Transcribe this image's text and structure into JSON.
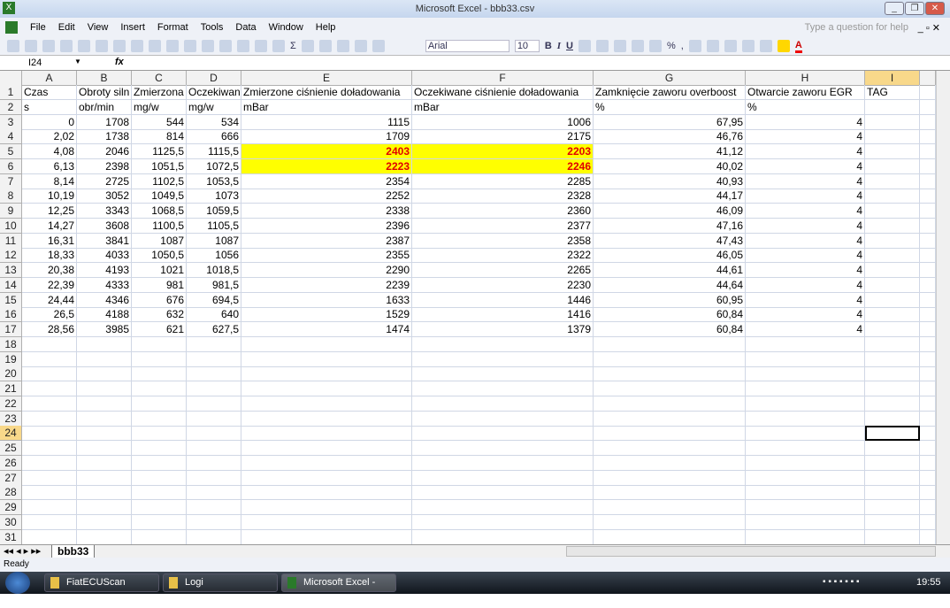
{
  "window": {
    "title": "Microsoft Excel - bbb33.csv"
  },
  "menu": [
    "File",
    "Edit",
    "View",
    "Insert",
    "Format",
    "Tools",
    "Data",
    "Window",
    "Help"
  ],
  "help_box": "Type a question for help",
  "toolbar": {
    "font": "Arial",
    "size": "10",
    "sigma": "Σ"
  },
  "formula_bar": {
    "name_box": "I24",
    "fx": "fx",
    "value": ""
  },
  "columns": [
    "A",
    "B",
    "C",
    "D",
    "E",
    "F",
    "G",
    "H",
    "I"
  ],
  "rows": [
    [
      "Czas",
      "Obroty siln",
      "Zmierzona",
      "Oczekiwan",
      "Zmierzone ciśnienie doładowania",
      "Oczekiwane ciśnienie doładowania",
      "Zamknięcie zaworu overboost",
      "Otwarcie zaworu EGR",
      "TAG"
    ],
    [
      "s",
      "obr/min",
      "mg/w",
      "mg/w",
      "mBar",
      "mBar",
      "%",
      "%",
      ""
    ],
    [
      "0",
      "1708",
      "544",
      "534",
      "1115",
      "1006",
      "67,95",
      "4",
      ""
    ],
    [
      "2,02",
      "1738",
      "814",
      "666",
      "1709",
      "2175",
      "46,76",
      "4",
      ""
    ],
    [
      "4,08",
      "2046",
      "1125,5",
      "1115,5",
      "2403",
      "2203",
      "41,12",
      "4",
      ""
    ],
    [
      "6,13",
      "2398",
      "1051,5",
      "1072,5",
      "2223",
      "2246",
      "40,02",
      "4",
      ""
    ],
    [
      "8,14",
      "2725",
      "1102,5",
      "1053,5",
      "2354",
      "2285",
      "40,93",
      "4",
      ""
    ],
    [
      "10,19",
      "3052",
      "1049,5",
      "1073",
      "2252",
      "2328",
      "44,17",
      "4",
      ""
    ],
    [
      "12,25",
      "3343",
      "1068,5",
      "1059,5",
      "2338",
      "2360",
      "46,09",
      "4",
      ""
    ],
    [
      "14,27",
      "3608",
      "1100,5",
      "1105,5",
      "2396",
      "2377",
      "47,16",
      "4",
      ""
    ],
    [
      "16,31",
      "3841",
      "1087",
      "1087",
      "2387",
      "2358",
      "47,43",
      "4",
      ""
    ],
    [
      "18,33",
      "4033",
      "1050,5",
      "1056",
      "2355",
      "2322",
      "46,05",
      "4",
      ""
    ],
    [
      "20,38",
      "4193",
      "1021",
      "1018,5",
      "2290",
      "2265",
      "44,61",
      "4",
      ""
    ],
    [
      "22,39",
      "4333",
      "981",
      "981,5",
      "2239",
      "2230",
      "44,64",
      "4",
      ""
    ],
    [
      "24,44",
      "4346",
      "676",
      "694,5",
      "1633",
      "1446",
      "60,95",
      "4",
      ""
    ],
    [
      "26,5",
      "4188",
      "632",
      "640",
      "1529",
      "1416",
      "60,84",
      "4",
      ""
    ],
    [
      "28,56",
      "3985",
      "621",
      "627,5",
      "1474",
      "1379",
      "60,84",
      "4",
      ""
    ]
  ],
  "total_rows": 31,
  "selected_cell": "I24",
  "sheet_tab": "bbb33",
  "status": "Ready",
  "taskbar": {
    "items": [
      "FiatECUScan",
      "Logi",
      "Microsoft Excel - bb..."
    ],
    "clock": "19:55"
  },
  "colors": {
    "highlight": "#ffff00",
    "highlight_text": "#e00000"
  }
}
